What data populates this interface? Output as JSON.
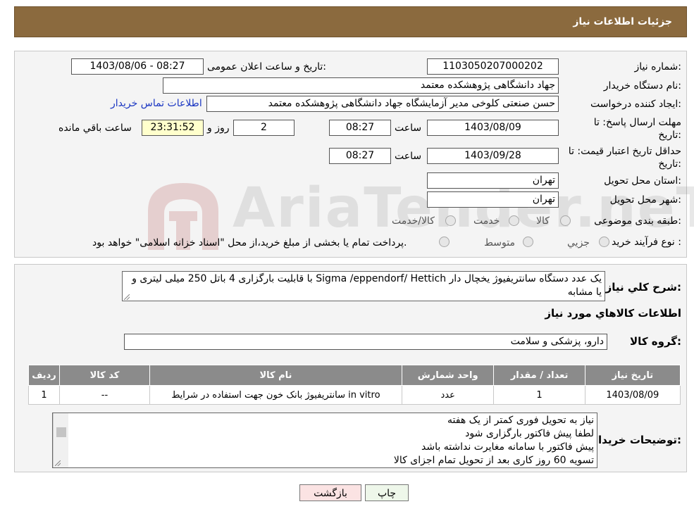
{
  "header": {
    "title": "جزئیات اطلاعات نیاز"
  },
  "form": {
    "need_number": {
      "label": "شماره نیاز:",
      "value": "1103050207000202"
    },
    "announce_datetime": {
      "label": "تاریخ و ساعت اعلان عمومی:",
      "value": "1403/08/06 - 08:27"
    },
    "buyer_org": {
      "label": "نام دستگاه خریدار:",
      "value": "جهاد دانشگاهی پژوهشکده معتمد"
    },
    "requester": {
      "label": "ایجاد کننده درخواست:",
      "value": "حسن صنعتی کلوخی مدیر آزمایشگاه جهاد دانشگاهی پژوهشکده معتمد"
    },
    "contact_link": "اطلاعات تماس خریدار",
    "reply_deadline": {
      "label_line1": "مهلت ارسال پاسخ: تا",
      "label_line2": "تاریخ:",
      "date": "1403/08/09",
      "time_label": "ساعت",
      "time": "08:27",
      "days": "2",
      "days_label": "روز و",
      "remaining": "23:31:52",
      "remaining_label": "ساعت باقي مانده"
    },
    "price_validity": {
      "label_line1": "حداقل تاریخ اعتبار قیمت: تا",
      "label_line2": "تاریخ:",
      "date": "1403/09/28",
      "time_label": "ساعت",
      "time": "08:27"
    },
    "delivery_province": {
      "label": "استان محل تحویل:",
      "value": "تهران"
    },
    "delivery_city": {
      "label": "شهر محل تحویل:",
      "value": "تهران"
    },
    "category": {
      "label": "طبقه بندی موضوعی:",
      "options": [
        "کالا",
        "خدمت",
        "کالا/خدمت"
      ]
    },
    "purchase_type": {
      "label": "نوع فرآیند خرید :",
      "options": [
        "جزيي",
        "متوسط"
      ],
      "note": "پرداخت تمام یا بخشی از مبلغ خرید،از محل \"اسناد خزانه اسلامی\" خواهد بود."
    }
  },
  "description": {
    "label": "شرح کلي نياز:",
    "text": "یک عدد دستگاه سانتریفیوژ یخچال دار Sigma /eppendorf/ Hettich با قابلیت بارگزاری 4 باتل 250 میلی لیتری و یا مشابه"
  },
  "goods": {
    "section_title": "اطلاعات کالاهاي مورد نياز",
    "group_label": "گروه کالا:",
    "group_value": "دارو، پزشکی و سلامت",
    "columns": [
      "رديف",
      "کد کالا",
      "نام کالا",
      "واحد شمارش",
      "تعداد / مقدار",
      "تاریخ نیاز"
    ],
    "rows": [
      [
        "1",
        "--",
        "سانتریفیوژ بانک خون جهت استفاده در شرایط in vitro",
        "عدد",
        "1",
        "1403/08/09"
      ]
    ]
  },
  "buyer_notes": {
    "label": "توضیحات خریدار:",
    "lines": [
      "نیاز به تحویل فوری کمتر از یک هفته",
      "لطفا پیش فاکتور بارگزاری شود",
      "پیش فاکتور با سامانه مغایرت نداشته باشد",
      "تسویه 60 روز کاری بعد از تحویل تمام اجزای کالا"
    ]
  },
  "buttons": {
    "print": "چاپ",
    "back": "بازگشت"
  },
  "watermark": {
    "text": "AriaTender.neT"
  },
  "colors": {
    "header_bg": "#8b6a3e",
    "table_header_bg": "#8b8b8b",
    "print_button_bg": "#eef7ea",
    "back_button_bg": "#fbe3e3",
    "link": "#1a36c2"
  }
}
